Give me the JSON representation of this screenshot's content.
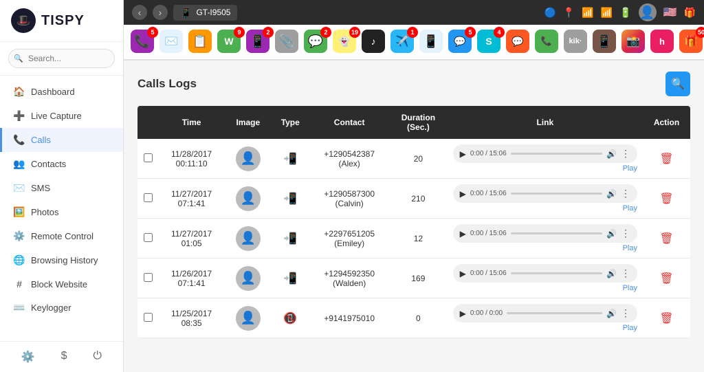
{
  "app": {
    "name": "TISPY",
    "logo_emoji": "🎩"
  },
  "topbar": {
    "device_name": "GT-I9505",
    "device_icon": "📱",
    "icons": [
      "🔵",
      "📍",
      "📶",
      "📶",
      "🔋"
    ],
    "flag": "🇺🇸",
    "gift_icon": "🎁"
  },
  "sidebar": {
    "search_placeholder": "Search...",
    "nav_items": [
      {
        "id": "dashboard",
        "label": "Dashboard",
        "icon": "🏠"
      },
      {
        "id": "live-capture",
        "label": "Live Capture",
        "icon": "➕"
      },
      {
        "id": "calls",
        "label": "Calls",
        "icon": "📞",
        "active": true
      },
      {
        "id": "contacts",
        "label": "Contacts",
        "icon": "👥"
      },
      {
        "id": "sms",
        "label": "SMS",
        "icon": "✉️"
      },
      {
        "id": "photos",
        "label": "Photos",
        "icon": "🖼️"
      },
      {
        "id": "remote-control",
        "label": "Remote Control",
        "icon": "⚙️"
      },
      {
        "id": "browsing-history",
        "label": "Browsing History",
        "icon": "🌐"
      },
      {
        "id": "block-website",
        "label": "Block Website",
        "icon": "#"
      },
      {
        "id": "keylogger",
        "label": "Keylogger",
        "icon": "⌨️"
      }
    ],
    "footer_icons": [
      "⚙️",
      "$",
      "⏻"
    ]
  },
  "app_icons": [
    {
      "emoji": "📞",
      "color": "#9c27b0",
      "badge": "5"
    },
    {
      "emoji": "✉️",
      "color": "#e3f2fd",
      "badge": ""
    },
    {
      "emoji": "📋",
      "color": "#ff9800",
      "badge": ""
    },
    {
      "emoji": "💬",
      "color": "#4caf50",
      "badge": "9"
    },
    {
      "emoji": "📱",
      "color": "#9c27b0",
      "badge": "2"
    },
    {
      "emoji": "📎",
      "color": "#9e9e9e",
      "badge": ""
    },
    {
      "emoji": "💬",
      "color": "#4caf50",
      "badge": "2"
    },
    {
      "emoji": "👻",
      "color": "#fff176",
      "badge": "19"
    },
    {
      "emoji": "⚫",
      "color": "#212121",
      "badge": ""
    },
    {
      "emoji": "✈️",
      "color": "#29b6f6",
      "badge": "1"
    },
    {
      "emoji": "📱",
      "color": "#e3f2fd",
      "badge": ""
    },
    {
      "emoji": "💬",
      "color": "#2196f3",
      "badge": "5"
    },
    {
      "emoji": "S",
      "color": "#00bcd4",
      "badge": "4"
    },
    {
      "emoji": "💬",
      "color": "#ff5722",
      "badge": ""
    },
    {
      "emoji": "📞",
      "color": "#4caf50",
      "badge": ""
    },
    {
      "emoji": "K",
      "color": "#9e9e9e",
      "badge": ""
    },
    {
      "emoji": "📱",
      "color": "#795548",
      "badge": ""
    },
    {
      "emoji": "🔴",
      "color": "#f44336",
      "badge": ""
    },
    {
      "emoji": "🎵",
      "color": "#e91e63",
      "badge": ""
    },
    {
      "emoji": "🎁",
      "color": "#ff5722",
      "badge": "50"
    }
  ],
  "content": {
    "section_title": "Calls Logs",
    "filter_icon": "🔍",
    "table": {
      "columns": [
        "",
        "Time",
        "Image",
        "Type",
        "Contact",
        "Duration\n(Sec.)",
        "Link",
        "Action"
      ],
      "rows": [
        {
          "time": "11/28/2017\n00:11:10",
          "contact": "+1290542387\n(Alex)",
          "duration": "20",
          "call_type": "in",
          "audio_time": "0:00 / 15:06"
        },
        {
          "time": "11/27/2017\n07:1:41",
          "contact": "+1290587300\n(Calvin)",
          "duration": "210",
          "call_type": "in",
          "audio_time": "0:00 / 15:06"
        },
        {
          "time": "11/27/2017\n01:05",
          "contact": "+2297651205\n(Emiley)",
          "duration": "12",
          "call_type": "in",
          "audio_time": "0:00 / 15:06"
        },
        {
          "time": "11/26/2017\n07:1:41",
          "contact": "+1294592350\n(Walden)",
          "duration": "169",
          "call_type": "in",
          "audio_time": "0:00 / 15:06"
        },
        {
          "time": "11/25/2017\n08:35",
          "contact": "+9141975010",
          "duration": "0",
          "call_type": "out",
          "audio_time": "0:00 / 0:00"
        }
      ]
    }
  }
}
